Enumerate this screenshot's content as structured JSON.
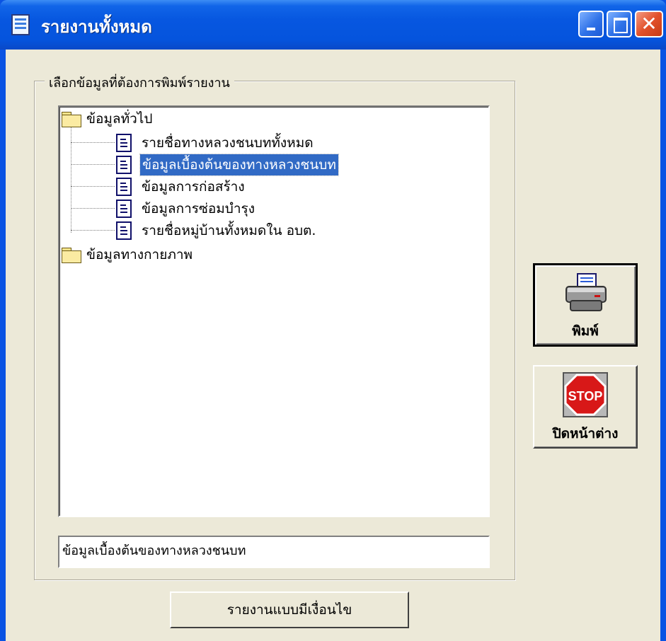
{
  "window": {
    "title": "รายงานทั้งหมด",
    "controls": {
      "minimize": "minimize-icon",
      "maximize": "maximize-icon",
      "close": "close-icon"
    },
    "colors": {
      "titlebar": "#0554dd",
      "client": "#ece9d8",
      "selection": "#316ac5",
      "close_button": "#e2512a"
    }
  },
  "group": {
    "legend": "เลือกข้อมูลที่ต้องการพิมพ์รายงาน"
  },
  "tree": {
    "folders": [
      {
        "label": "ข้อมูลทั่วไป",
        "icon": "folder-icon",
        "items": [
          {
            "label": "รายชื่อทางหลวงชนบททั้งหมด",
            "icon": "document-icon",
            "selected": false
          },
          {
            "label": "ข้อมูลเบื้องต้นของทางหลวงชนบท",
            "icon": "document-icon",
            "selected": true
          },
          {
            "label": "ข้อมูลการก่อสร้าง",
            "icon": "document-icon",
            "selected": false
          },
          {
            "label": "ข้อมูลการซ่อมบำรุง",
            "icon": "document-icon",
            "selected": false
          },
          {
            "label": "รายชื่อหมู่บ้านทั้งหมดใน อบต.",
            "icon": "document-icon",
            "selected": false
          }
        ]
      },
      {
        "label": "ข้อมูลทางกายภาพ",
        "icon": "folder-icon",
        "items": []
      }
    ]
  },
  "description": "ข้อมูลเบื้องต้นของทางหลวงชนบท",
  "buttons": {
    "print": {
      "label": "พิมพ์",
      "icon": "printer-icon"
    },
    "close_window": {
      "label": "ปิดหน้าต่าง",
      "icon": "stop-sign-icon",
      "icon_text": "STOP"
    },
    "conditional_report": {
      "label": "รายงานแบบมีเงื่อนไข"
    }
  }
}
